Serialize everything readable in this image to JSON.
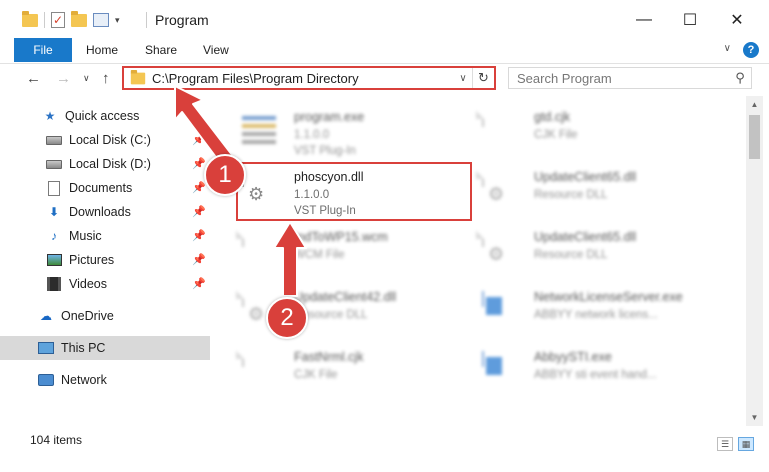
{
  "window": {
    "title": "Program",
    "minimize_glyph": "—",
    "maximize_glyph": "☐",
    "close_glyph": "✕"
  },
  "ribbon": {
    "tabs": [
      {
        "label": "File"
      },
      {
        "label": "Home"
      },
      {
        "label": "Share"
      },
      {
        "label": "View"
      }
    ],
    "expand_glyph": "∨",
    "help_glyph": "?"
  },
  "nav": {
    "back_glyph": "←",
    "forward_glyph": "→",
    "dropdown_glyph": "∨",
    "up_glyph": "↑",
    "address_path": "C:\\Program Files\\Program Directory",
    "address_chevron": "∨",
    "refresh_glyph": "↻",
    "search_placeholder": "Search Program",
    "search_glyph": "⚲"
  },
  "sidebar": {
    "items": [
      {
        "label": "Quick access",
        "icon": "star-icon",
        "pinned": false
      },
      {
        "label": "Local Disk (C:)",
        "icon": "disk-icon",
        "pinned": true
      },
      {
        "label": "Local Disk (D:)",
        "icon": "disk-icon",
        "pinned": true
      },
      {
        "label": "Documents",
        "icon": "document-icon",
        "pinned": true
      },
      {
        "label": "Downloads",
        "icon": "download-icon",
        "pinned": true
      },
      {
        "label": "Music",
        "icon": "music-icon",
        "pinned": true
      },
      {
        "label": "Pictures",
        "icon": "pictures-icon",
        "pinned": true
      },
      {
        "label": "Videos",
        "icon": "videos-icon",
        "pinned": true
      },
      {
        "label": "OneDrive",
        "icon": "cloud-icon",
        "pinned": false
      },
      {
        "label": "This PC",
        "icon": "computer-icon",
        "pinned": false,
        "selected": true
      },
      {
        "label": "Network",
        "icon": "network-icon",
        "pinned": false
      }
    ],
    "pin_glyph": "📌"
  },
  "files": [
    {
      "name": "program.exe",
      "line1": "1.1.0.0",
      "line2": "VST Plug-In",
      "icon": "exe-icon"
    },
    {
      "name": "gtd.cjk",
      "line1": "CJK File",
      "line2": "",
      "icon": "file-icon"
    },
    {
      "name": "phoscyon.dll",
      "line1": "1.1.0.0",
      "line2": "VST Plug-In",
      "icon": "gear-file-icon",
      "highlighted": true
    },
    {
      "name": "UpdateClient65.dll",
      "line1": "Resource DLL",
      "line2": "",
      "icon": "gear-file-icon"
    },
    {
      "name": "IndToWP15.wcm",
      "line1": "WCM File",
      "line2": "",
      "icon": "file-icon"
    },
    {
      "name": "UpdateClient65.dll",
      "line1": "Resource DLL",
      "line2": "",
      "icon": "gear-file-icon"
    },
    {
      "name": "UpdateClient42.dll",
      "line1": "Resource DLL",
      "line2": "",
      "icon": "gear-file-icon"
    },
    {
      "name": "NetworkLicenseServer.exe",
      "line1": "ABBYY network licens...",
      "line2": "",
      "icon": "app-icon"
    },
    {
      "name": "FastNrml.cjk",
      "line1": "CJK File",
      "line2": "",
      "icon": "file-icon"
    },
    {
      "name": "AbbyySTI.exe",
      "line1": "ABBYY sti event hand...",
      "line2": "",
      "icon": "app-icon"
    }
  ],
  "status": {
    "item_count": "104 items",
    "details_view_glyph": "☰",
    "large_icons_view_glyph": "▦"
  },
  "annotations": {
    "step1": "1",
    "step2": "2",
    "color": "#d9403b"
  }
}
